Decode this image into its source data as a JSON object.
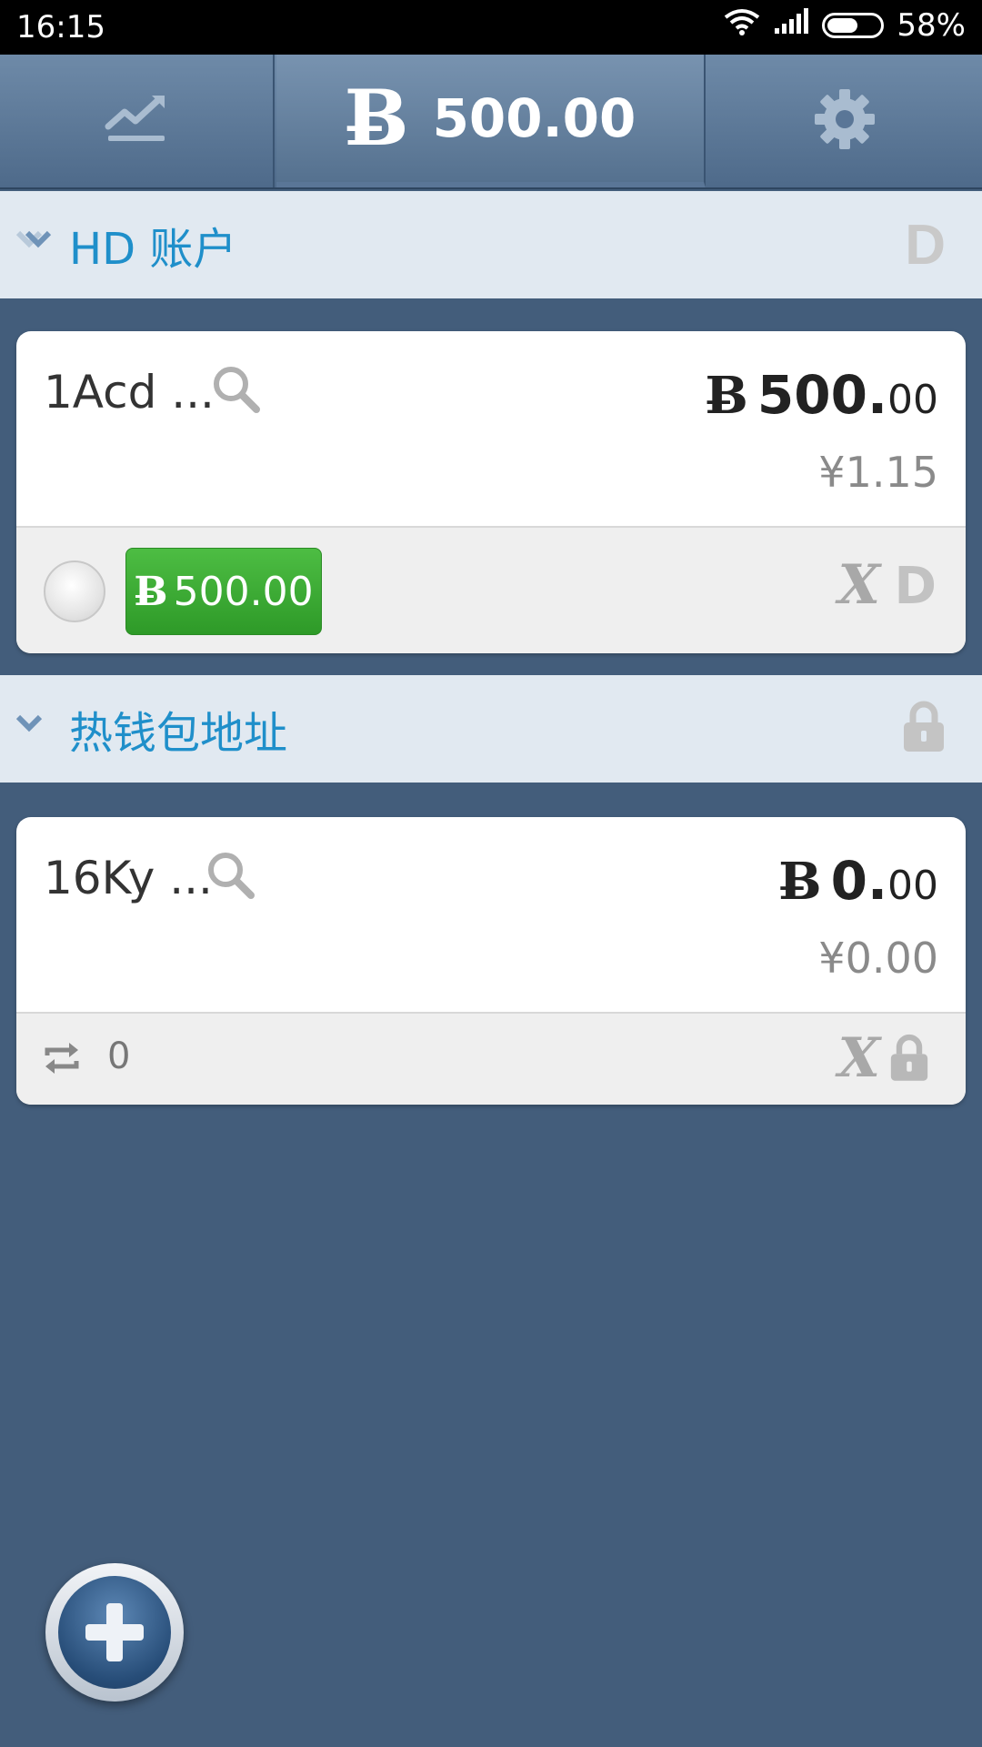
{
  "status_bar": {
    "time": "16:15",
    "battery": "58%",
    "battery_level": 0.58
  },
  "top_bar": {
    "currency_symbol": "Ƀ",
    "total_balance": "500.00"
  },
  "sections": [
    {
      "title": "HD 账户",
      "header_right_icon": "D-icon",
      "card": {
        "address": "1Acd ...",
        "btc_symbol": "Ƀ",
        "balance_int": "500.",
        "balance_dec": "00",
        "fiat": "¥1.15",
        "button_label": "500.00",
        "button_symbol": "Ƀ"
      }
    },
    {
      "title": "热钱包地址",
      "header_right_icon": "lock-icon",
      "card": {
        "address": "16Ky ...",
        "btc_symbol": "Ƀ",
        "balance_int": "0.",
        "balance_dec": "00",
        "fiat": "¥0.00",
        "tx_count": "0"
      }
    }
  ],
  "icons": {
    "d_letter": "D",
    "x_letter": "X"
  },
  "colors": {
    "background": "#435d7b",
    "accent_text": "#1f8fca",
    "green_button": "#3aae33"
  }
}
